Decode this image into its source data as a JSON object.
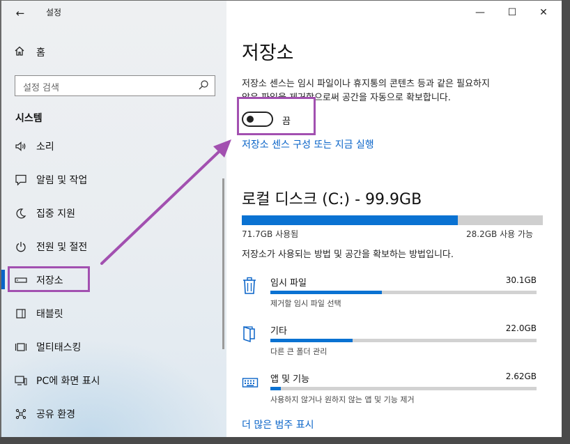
{
  "window": {
    "title": "설정",
    "controls": {
      "minimize": "—",
      "maximize": "☐",
      "close": "✕"
    }
  },
  "sidebar": {
    "home": "홈",
    "search_placeholder": "설정 검색",
    "section": "시스템",
    "items": [
      {
        "label": "소리",
        "icon": "speaker-icon"
      },
      {
        "label": "알림 및 작업",
        "icon": "message-icon"
      },
      {
        "label": "집중 지원",
        "icon": "moon-icon"
      },
      {
        "label": "전원 및 절전",
        "icon": "power-icon"
      },
      {
        "label": "저장소",
        "icon": "storage-icon",
        "selected": true
      },
      {
        "label": "태블릿",
        "icon": "tablet-icon"
      },
      {
        "label": "멀티태스킹",
        "icon": "multitasking-icon"
      },
      {
        "label": "PC에 화면 표시",
        "icon": "project-icon"
      },
      {
        "label": "공유 환경",
        "icon": "share-icon"
      }
    ]
  },
  "main": {
    "title": "저장소",
    "description_line1": "저장소 센스는 임시 파일이나 휴지통의 콘텐츠 등과 같은 필요하지",
    "description_line2": "않은 파일을 제거함으로써 공간을 자동으로 확보합니다.",
    "toggle": {
      "state": "off",
      "label": "끔"
    },
    "config_link": "저장소 센스 구성 또는 지금 실행",
    "disk": {
      "title": "로컬 디스크 (C:) - 99.9GB",
      "used_label": "71.7GB 사용됨",
      "free_label": "28.2GB 사용 가능",
      "used_fraction": 0.718
    },
    "usage_description": "저장소가 사용되는 방법 및 공간을 확보하는 방법입니다.",
    "categories": [
      {
        "name": "임시 파일",
        "size": "30.1GB",
        "sub": "제거할 임시 파일 선택",
        "fraction": 0.42,
        "icon": "trash-icon"
      },
      {
        "name": "기타",
        "size": "22.0GB",
        "sub": "다른 큰 폴더 관리",
        "fraction": 0.31,
        "icon": "folder-icon"
      },
      {
        "name": "앱 및 기능",
        "size": "2.62GB",
        "sub": "사용하지 않거나 원하지 않는 앱 및 기능 제거",
        "fraction": 0.04,
        "icon": "keyboard-icon"
      }
    ],
    "more_link": "더 많은 범주 표시"
  },
  "colors": {
    "accent": "#0a64c8",
    "highlight": "#a250b0"
  }
}
